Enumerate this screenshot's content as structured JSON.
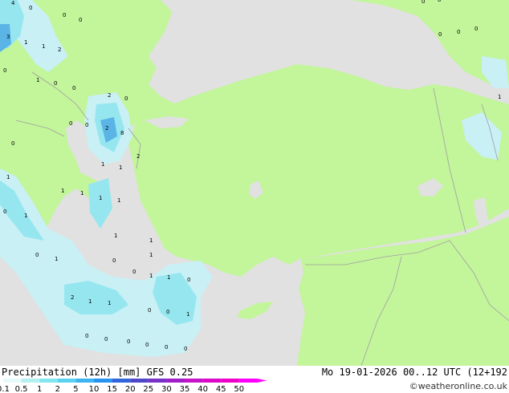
{
  "footer": {
    "title": "Precipitation (12h) [mm]  GFS 0.25",
    "valid": "Mo 19-01-2026 00..12 UTC (12+192",
    "credit": "©weatheronline.co.uk"
  },
  "legend": {
    "labels": [
      "0.1",
      "0.5",
      "1",
      "2",
      "5",
      "10",
      "15",
      "20",
      "25",
      "30",
      "35",
      "40",
      "45",
      "50"
    ],
    "colors": [
      "#e6fafa",
      "#b4f0f0",
      "#82e6f0",
      "#5ad2f0",
      "#3cb4f0",
      "#2894f0",
      "#3264dc",
      "#5046c8",
      "#7832c8",
      "#a01ec8",
      "#c814c8",
      "#dc0ac8",
      "#f000c8",
      "#ff00ff"
    ]
  },
  "colors": {
    "land": "#c3f59b",
    "sea_dry": "#e1e1e1",
    "border": "#a0a0a0",
    "precip_light": "#c8f0f5",
    "precip_mid": "#96e6f0",
    "precip_heavy": "#5ab4e6"
  },
  "map_values": [
    "4",
    "0",
    "0",
    "0",
    "3",
    "1",
    "1",
    "2",
    "0",
    "1",
    "0",
    "0",
    "2",
    "0",
    "0",
    "0",
    "2",
    "8",
    "0",
    "1",
    "1",
    "2",
    "1",
    "1",
    "1",
    "1",
    "1",
    "0",
    "1",
    "1",
    "1",
    "1",
    "0",
    "1",
    "0",
    "0",
    "1",
    "1",
    "0",
    "2",
    "1",
    "1",
    "0",
    "0",
    "1",
    "0",
    "0",
    "0",
    "0",
    "0",
    "0",
    "0",
    "0",
    "0",
    "0",
    "1",
    "0"
  ]
}
